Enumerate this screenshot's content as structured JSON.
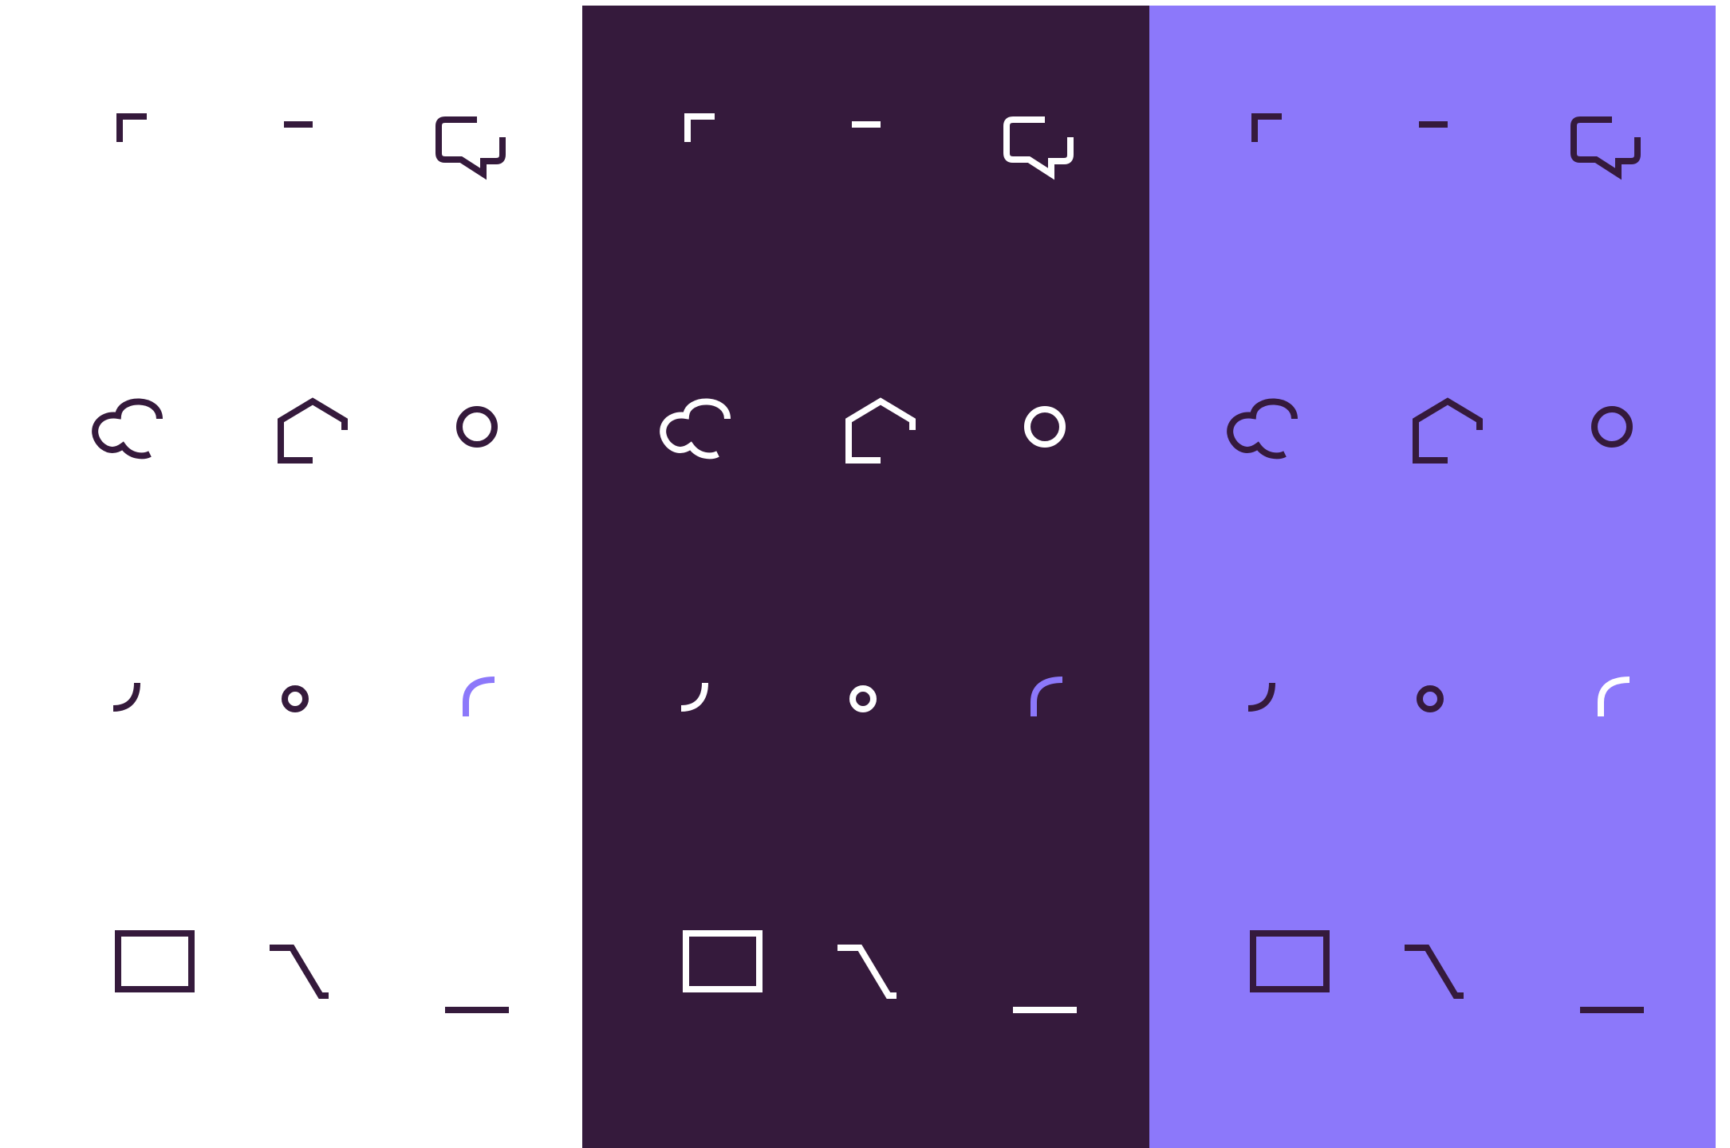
{
  "panels": [
    {
      "theme": "light",
      "background": "#ffffff",
      "base": "#351a3c",
      "accent": "#8c78fa"
    },
    {
      "theme": "dark",
      "background": "#351a3c",
      "base": "#ffffff",
      "accent": "#8c78fa"
    },
    {
      "theme": "violet",
      "background": "#8c78fa",
      "base": "#351a3c",
      "accent": "#ffffff"
    }
  ],
  "icons": [
    "expand-icon",
    "smile-icon",
    "chat-icon",
    "cloud-icon",
    "home-icon",
    "user-icon",
    "signal-icon",
    "percent-icon",
    "unlock-icon",
    "monitor-icon",
    "shuffle-icon",
    "growth-chart-icon"
  ]
}
